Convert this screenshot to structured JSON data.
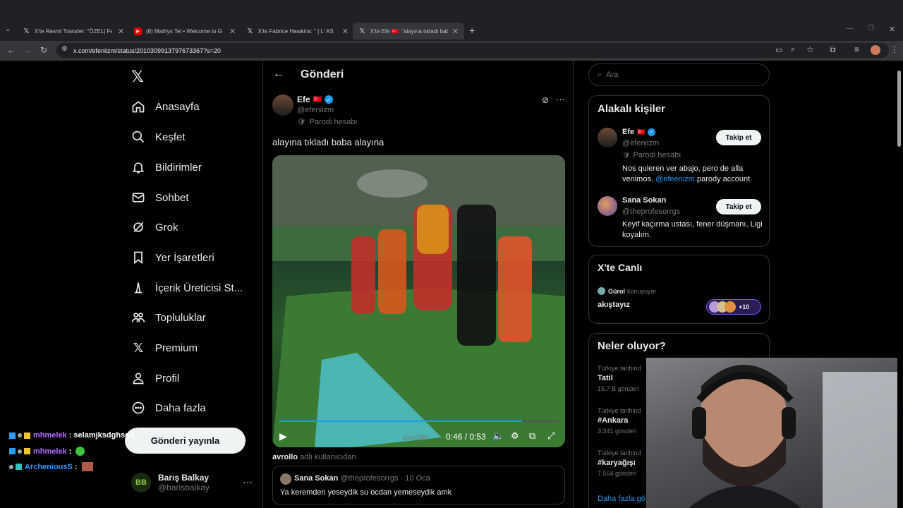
{
  "browser": {
    "tabs": [
      {
        "title": "X'te Resmi Transfer: \"ÖZEL| Fen",
        "icon": "x-icon"
      },
      {
        "title": "(8) Mathys Tel • Welcome to G",
        "icon": "youtube-icon"
      },
      {
        "title": "X'te Fabrice Hawkins: \" | L' AS",
        "icon": "x-icon"
      },
      {
        "title": "X'te Efe 🇹🇷: \"alayına tıkladı baba",
        "icon": "x-icon"
      }
    ],
    "url": "x.com/efeniizm/status/2010309913797673367?s=20"
  },
  "nav": {
    "items": [
      {
        "label": "Anasayfa",
        "icon": "home-icon"
      },
      {
        "label": "Keşfet",
        "icon": "search-icon"
      },
      {
        "label": "Bildirimler",
        "icon": "bell-icon"
      },
      {
        "label": "Sohbet",
        "icon": "mail-icon"
      },
      {
        "label": "Grok",
        "icon": "grok-icon"
      },
      {
        "label": "Yer İşaretleri",
        "icon": "bookmark-icon"
      },
      {
        "label": "İçerik Üreticisi St...",
        "icon": "creator-icon"
      },
      {
        "label": "Topluluklar",
        "icon": "communities-icon"
      },
      {
        "label": "Premium",
        "icon": "x-icon"
      },
      {
        "label": "Profil",
        "icon": "profile-icon"
      },
      {
        "label": "Daha fazla",
        "icon": "more-icon"
      }
    ],
    "post_button": "Gönderi yayınla",
    "account": {
      "name": "Barış Balkay",
      "handle": "@barisbalkay",
      "avatar_text": "BB"
    }
  },
  "main": {
    "header_title": "Gönderi",
    "post": {
      "author": "Efe",
      "flag": "🇹🇷",
      "handle": "@efeniizm",
      "parody_label": "Parodi hesabı",
      "text": "alayına tıkladı baba alayına",
      "video_time": "0:46 / 0:53",
      "video_progress": 0.868,
      "watermark": "avrollo",
      "caption_user": "avrollo",
      "caption_suffix": "adlı kullanıcıdan"
    },
    "reply": {
      "name": "Sana Sokan",
      "handle": "@theprofesorrgs",
      "date": "· 10 Oca",
      "text": "Ya keremden yeseydik su ocdan yemeseydik amk"
    }
  },
  "sidebar": {
    "search_placeholder": "Ara",
    "relevant": {
      "title": "Alakalı kişiler",
      "people": [
        {
          "name": "Efe",
          "flag": "🇹🇷",
          "handle": "@efeniizm",
          "badge": "Parodi hesabı",
          "bio": "Nos quieren ver abajo, pero de alla venimos.",
          "bio_link": "@efeenizm",
          "bio_tail": " parody account",
          "follow": "Takip et"
        },
        {
          "name": "Sana Sokan",
          "handle": "@theprofesorrgs",
          "bio": "Keyif kaçırma ustası, fener düşmanı, Ligi koyalım.",
          "follow": "Takip et"
        }
      ]
    },
    "live": {
      "title": "X'te Canlı",
      "host": "Gürol",
      "host_suffix": "konuşuyor",
      "space_title": "akıştayız",
      "listener_extra": "+10"
    },
    "trends": {
      "title": "Neler oluyor?",
      "items": [
        {
          "context": "Türkiye tarihind",
          "name": "Tatil",
          "count": "15,7 B gönderi"
        },
        {
          "context": "Türkiye tarihind",
          "name": "#Ankara",
          "count": "3.341 gönderi"
        },
        {
          "context": "Türkiye tarihind",
          "name": "#karyağışı",
          "count": "7.564 gönderi"
        }
      ],
      "more": "Daha fazla gö"
    }
  },
  "chat": [
    {
      "user": "mhmelek",
      "message": ": selamjksdghsgd",
      "color": "#b36bff"
    },
    {
      "user": "mhmelek",
      "message": ":",
      "color": "#b36bff"
    },
    {
      "user": "ArcheniousS",
      "message": ":",
      "color": "#2e9cff"
    }
  ],
  "colors": {
    "accent": "#1d9bf0",
    "border": "#2f3336",
    "muted": "#71767b"
  }
}
